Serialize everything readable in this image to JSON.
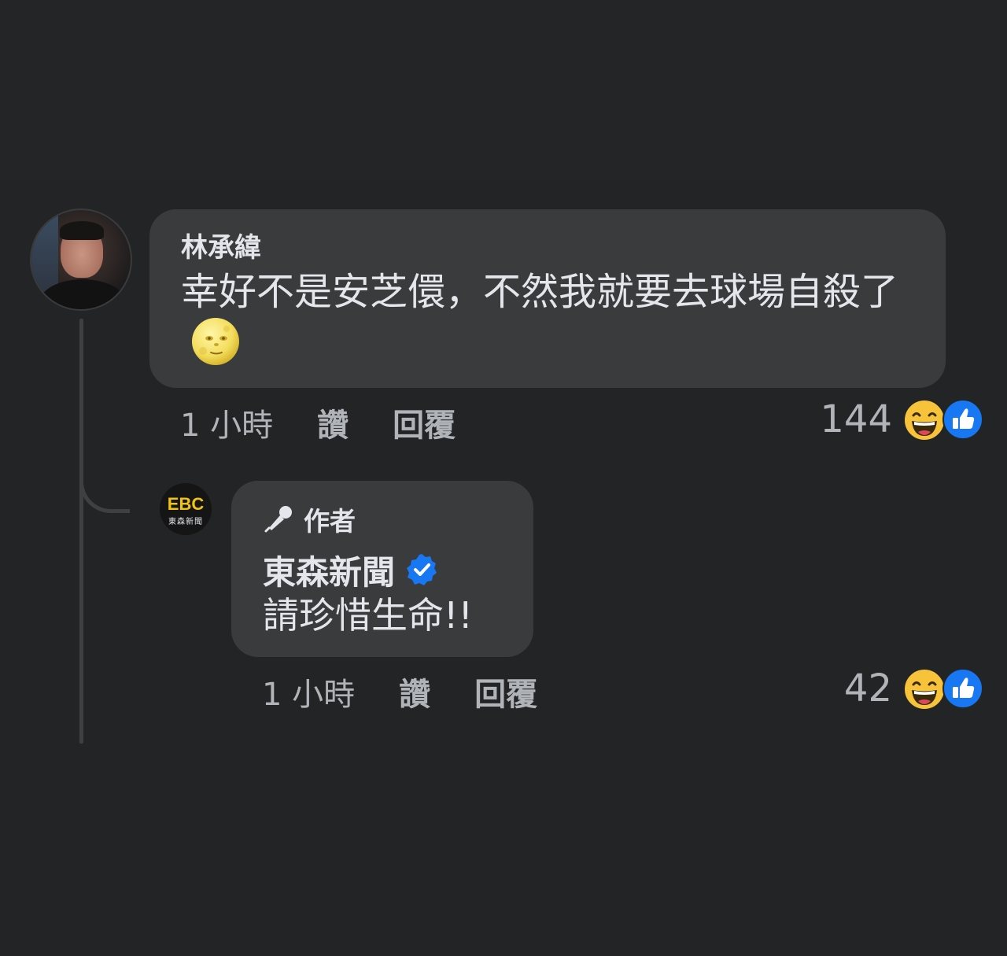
{
  "comment": {
    "author": "林承緯",
    "text": "幸好不是安芝儇，不然我就要去球場自殺了",
    "emoji_icon": "full-moon-face-emoji",
    "time": "1 小時",
    "like_label": "讚",
    "reply_label": "回覆",
    "reaction_count": "144",
    "reaction_icons": [
      "laughing-face-icon",
      "thumbs-up-icon"
    ]
  },
  "reply": {
    "badge_label": "作者",
    "badge_icon": "microphone-icon",
    "avatar_logo_top": "EBC",
    "avatar_logo_bottom": "東森新聞",
    "author": "東森新聞",
    "verified_icon": "verified-badge-icon",
    "text": "請珍惜生命!!",
    "time": "1 小時",
    "like_label": "讚",
    "reply_label": "回覆",
    "reaction_count": "42",
    "reaction_icons": [
      "laughing-face-icon",
      "thumbs-up-icon"
    ]
  },
  "colors": {
    "background": "#232425",
    "bubble": "#3a3b3c",
    "primary_text": "#e4e6eb",
    "secondary_text": "#b0b3b8",
    "facebook_blue": "#1877f2",
    "ebc_gold": "#f1c40f"
  }
}
